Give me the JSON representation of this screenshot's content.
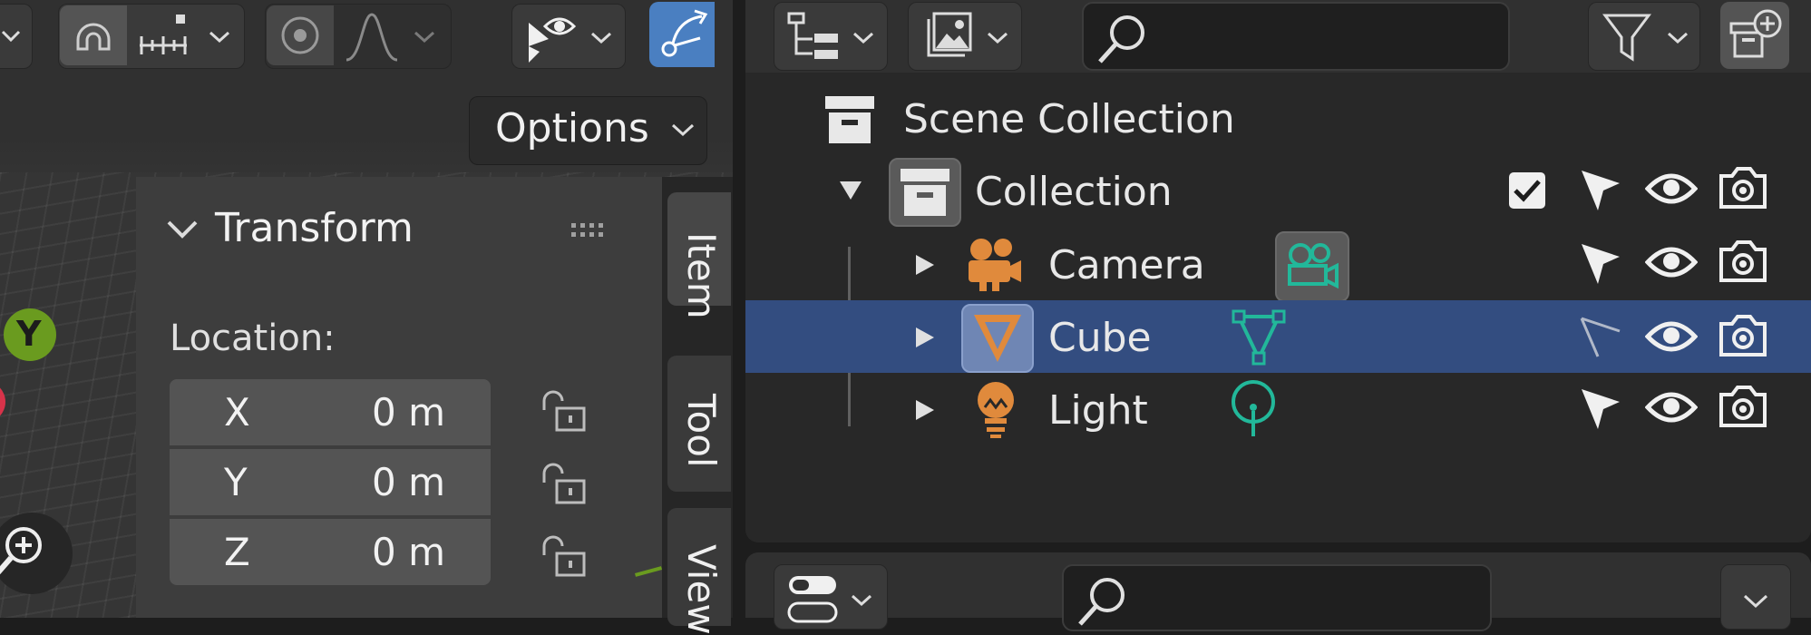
{
  "viewport": {
    "options_label": "Options",
    "panel_title": "Transform",
    "location_label": "Location:",
    "location": [
      {
        "axis": "X",
        "value": "0 m"
      },
      {
        "axis": "Y",
        "value": "0 m"
      },
      {
        "axis": "Z",
        "value": "0 m"
      }
    ],
    "gizmo_y_label": "Y",
    "tabs": [
      "Item",
      "Tool",
      "View"
    ]
  },
  "outliner": {
    "scene_collection": "Scene Collection",
    "collection": "Collection",
    "objects": [
      {
        "name": "Camera",
        "selected": false
      },
      {
        "name": "Cube",
        "selected": true
      },
      {
        "name": "Light",
        "selected": false
      }
    ],
    "search_value": "",
    "props_search_value": ""
  },
  "colors": {
    "selection": "#334d80",
    "object_orange": "#e08a3c",
    "data_teal": "#22b89a",
    "gizmo_y": "#6a9b1f",
    "gizmo_x": "#d8334a",
    "active_tool": "#4a7fc1"
  },
  "icons": [
    "chevron-down-icon",
    "snap-magnet-icon",
    "snap-increment-icon",
    "proportional-edit-icon",
    "falloff-curve-icon",
    "visibility-icon",
    "transform-gizmo-icon",
    "outliner-display-mode-icon",
    "image-icon",
    "search-icon",
    "filter-icon",
    "new-collection-icon",
    "collection-box-icon",
    "disclosure-triangle-icon",
    "checkbox-icon",
    "select-arrow-icon",
    "eye-icon",
    "camera-render-icon",
    "camera-object-icon",
    "camera-data-icon",
    "mesh-object-icon",
    "mesh-data-icon",
    "light-object-icon",
    "light-data-icon",
    "lock-icon",
    "zoom-icon"
  ]
}
